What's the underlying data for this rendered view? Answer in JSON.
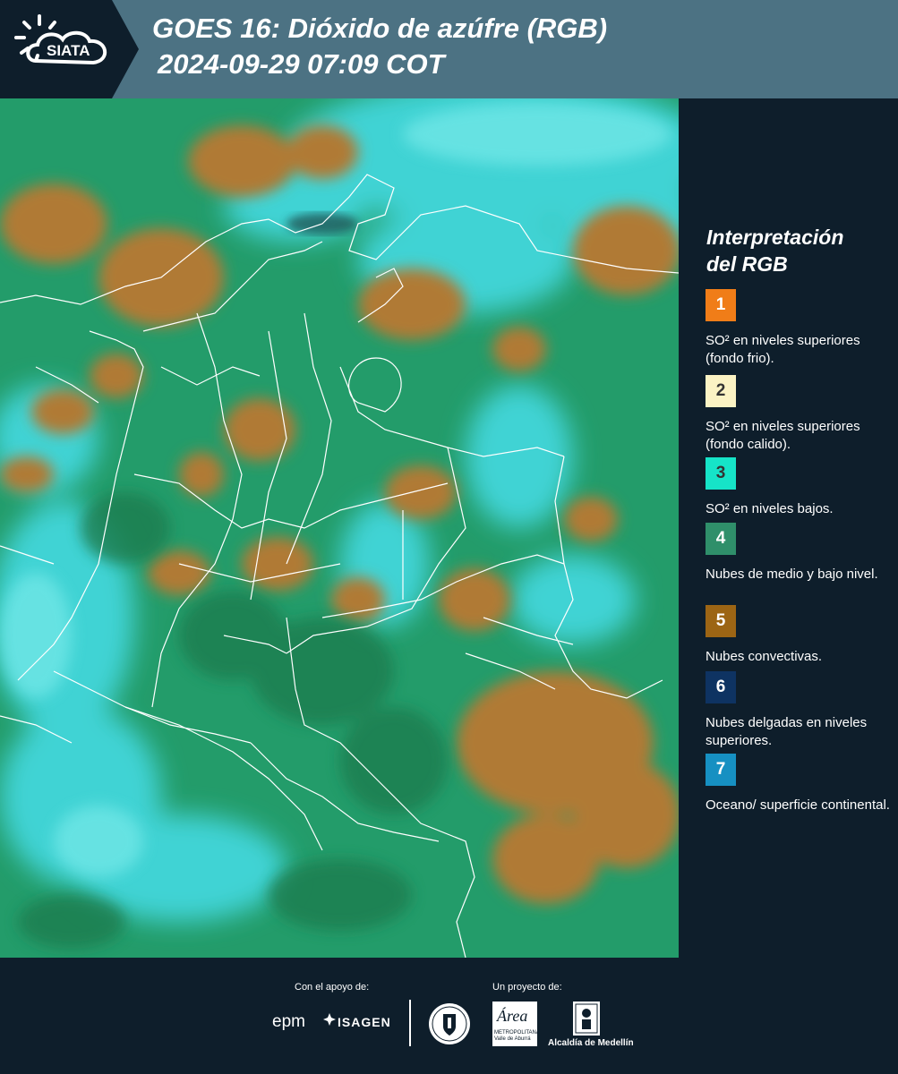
{
  "header": {
    "logo_text": "SIATA",
    "title_line1": "GOES 16: Dióxido de azúfre (RGB)",
    "title_line2": "2024-09-29 07:09 COT"
  },
  "legend": {
    "title_line1": "Interpretación",
    "title_line2": "del RGB",
    "items": [
      {
        "num": "1",
        "color": "#f07d18",
        "text_color": "#ffffff",
        "desc": "SO² en niveles superiores (fondo frio)."
      },
      {
        "num": "2",
        "color": "#fbf3c4",
        "text_color": "#333333",
        "desc": "SO² en niveles superiores (fondo calido)."
      },
      {
        "num": "3",
        "color": "#16e4c8",
        "text_color": "#333333",
        "desc": "SO² en niveles bajos."
      },
      {
        "num": "4",
        "color": "#2f8f6a",
        "text_color": "#ffffff",
        "desc": "Nubes de medio y bajo nivel."
      },
      {
        "num": "5",
        "color": "#9c6514",
        "text_color": "#ffffff",
        "desc": "Nubes convectivas."
      },
      {
        "num": "6",
        "color": "#0e3362",
        "text_color": "#ffffff",
        "desc": "Nubes delgadas en niveles superiores."
      },
      {
        "num": "7",
        "color": "#1690c2",
        "text_color": "#ffffff",
        "desc": "Oceano/ superficie continental."
      }
    ]
  },
  "footer": {
    "support_label": "Con el apoyo de:",
    "project_label": "Un proyecto de:",
    "epm_logo_text": "epm",
    "isagen_logo_text": "ISAGEN",
    "area_logo_text": "Área",
    "area_subtitle": "METROPOLITANA Valle de Aburrá",
    "alcaldia_logo_text": "Alcaldía de Medellín"
  }
}
